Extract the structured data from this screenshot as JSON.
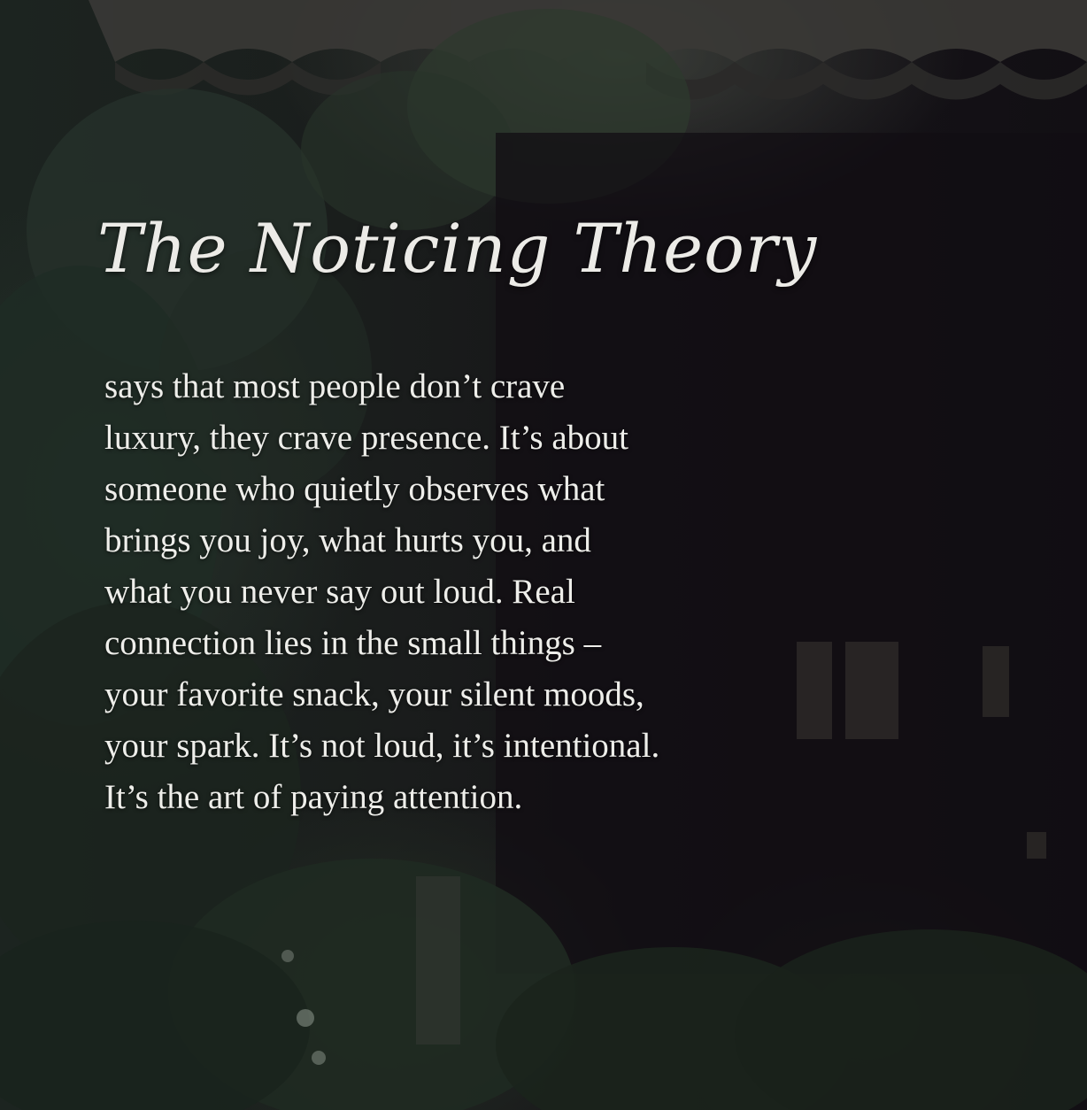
{
  "post": {
    "title": "The Noticing Theory",
    "lines": [
      "says that most people don’t crave",
      "luxury, they crave presence. It’s about",
      "someone who quietly observes what",
      "brings you joy, what hurts you, and",
      "what you never say out loud. Real",
      "connection lies in the small things –",
      "your favorite snack, your silent moods,",
      "your spark. It’s not loud, it’s intentional.",
      "It’s the art of paying attention."
    ]
  },
  "colors": {
    "text": "#eeeeea",
    "background": "#141316",
    "foliage": "#2a3a2c"
  }
}
